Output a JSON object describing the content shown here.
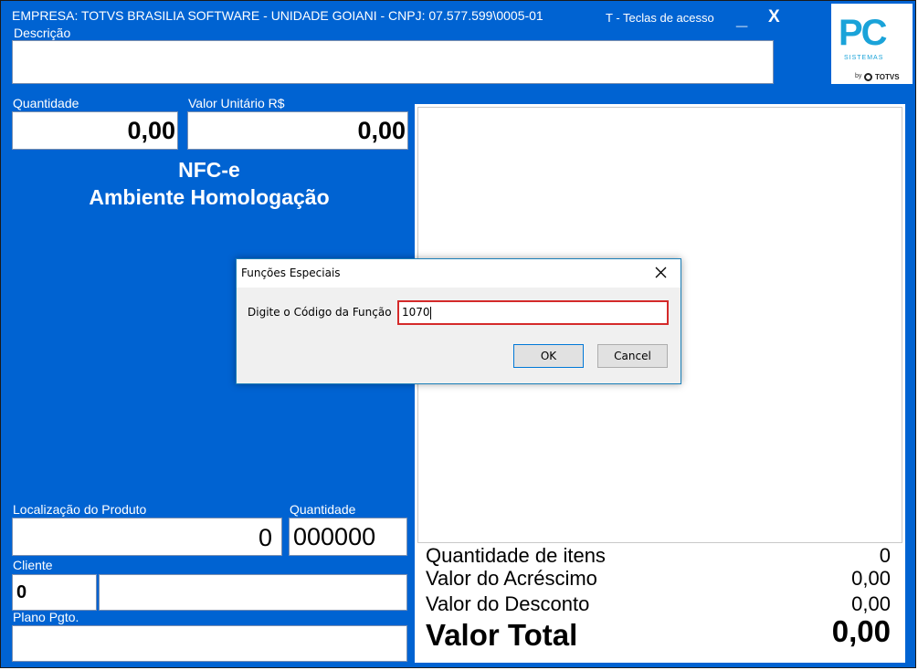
{
  "header": {
    "empresa": "EMPRESA: TOTVS BRASILIA SOFTWARE - UNIDADE GOIANI   -   CNPJ: 07.577.599\\0005-01",
    "shortcut": "T - Teclas de acesso",
    "minimize": "_",
    "close": "X"
  },
  "logo": {
    "big": "PC",
    "sub": "SISTEMAS",
    "by": "by",
    "brand": "TOTVS"
  },
  "descricao": {
    "label": "Descrição",
    "value": ""
  },
  "quantidade": {
    "label": "Quantidade",
    "value": "0,00"
  },
  "valor_unitario": {
    "label": "Valor Unitário R$",
    "value": "0,00"
  },
  "banner": {
    "line1": "NFC-e",
    "line2": "Ambiente Homologação"
  },
  "localizacao": {
    "label": "Localização do Produto",
    "value": "0"
  },
  "quantidade2": {
    "label": "Quantidade",
    "value": "000000"
  },
  "cliente": {
    "label": "Cliente",
    "code": "0",
    "name": ""
  },
  "plano": {
    "label": "Plano Pgto.",
    "value": ""
  },
  "totals": {
    "qtd_itens_label": "Quantidade de itens",
    "qtd_itens": "0",
    "acrescimo_label": "Valor do Acréscimo",
    "acrescimo": "0,00",
    "desconto_label": "Valor do Desconto",
    "desconto": "0,00",
    "total_label": "Valor Total",
    "total": "0,00"
  },
  "dialog": {
    "title": "Funções Especiais",
    "prompt": "Digite o Código da Função",
    "input_value": "1070",
    "ok": "OK",
    "cancel": "Cancel"
  }
}
